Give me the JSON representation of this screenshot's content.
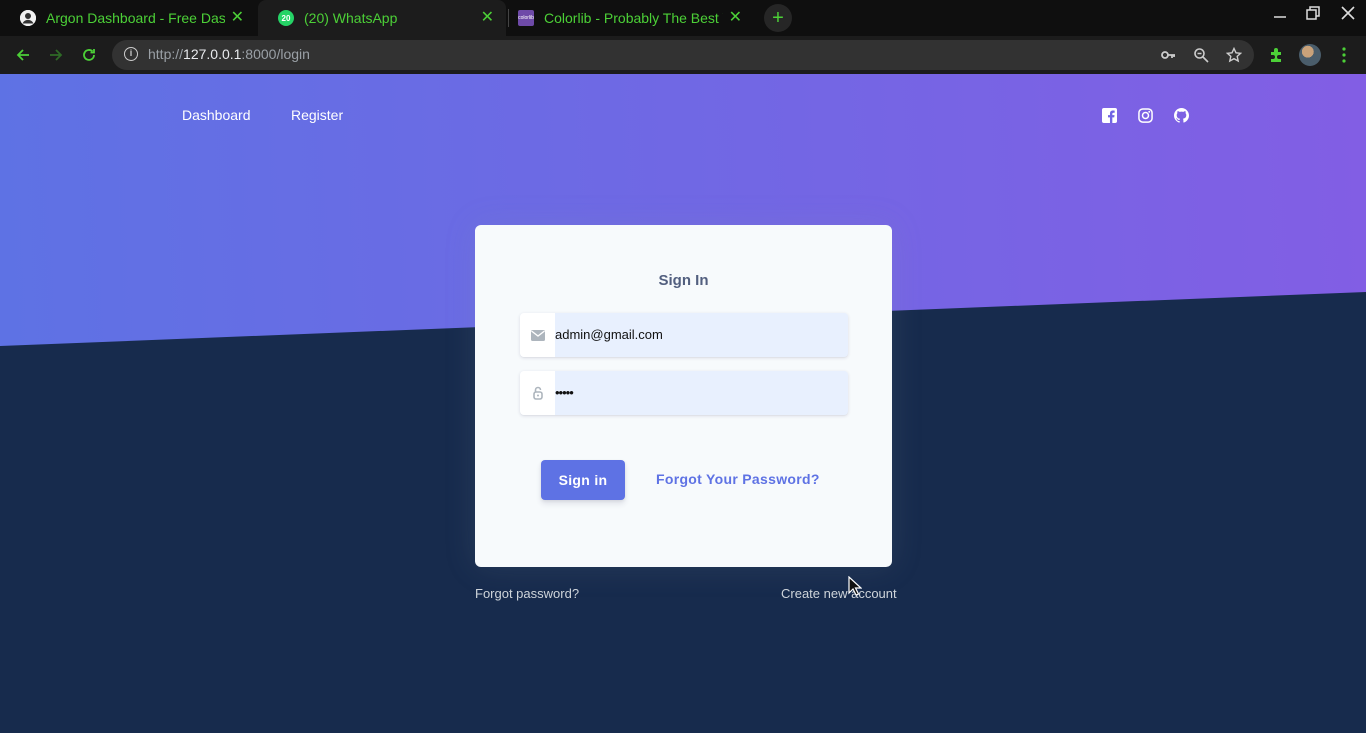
{
  "browser": {
    "tabs": [
      {
        "title": "Argon Dashboard - Free Dashboard",
        "favicon": "user-avatar-icon",
        "active": false
      },
      {
        "title": "(20) WhatsApp",
        "favicon": "whatsapp-icon",
        "badge": "20",
        "active": true
      },
      {
        "title": "Colorlib - Probably The Best WordPress Themes",
        "favicon": "colorlib-icon",
        "favicon_text": "colorlib",
        "active": false
      }
    ],
    "url_prefix": "http://",
    "url_host": "127.0.0.1",
    "url_path": ":8000/login",
    "accent_color": "#4cd037"
  },
  "nav": {
    "links": [
      "Dashboard",
      "Register"
    ],
    "social_icons": [
      "facebook-icon",
      "instagram-icon",
      "github-icon"
    ]
  },
  "login": {
    "title": "Sign In",
    "email_value": "admin@gmail.com",
    "email_icon": "envelope-icon",
    "password_value": "•••••",
    "password_icon": "lock-icon",
    "submit_label": "Sign in",
    "forgot_link": "Forgot Your Password?"
  },
  "footer_links": {
    "forgot": "Forgot password?",
    "create": "Create new account"
  },
  "colors": {
    "primary": "#5e72e4",
    "hero_end": "#825ee4",
    "background": "#172b4d"
  }
}
